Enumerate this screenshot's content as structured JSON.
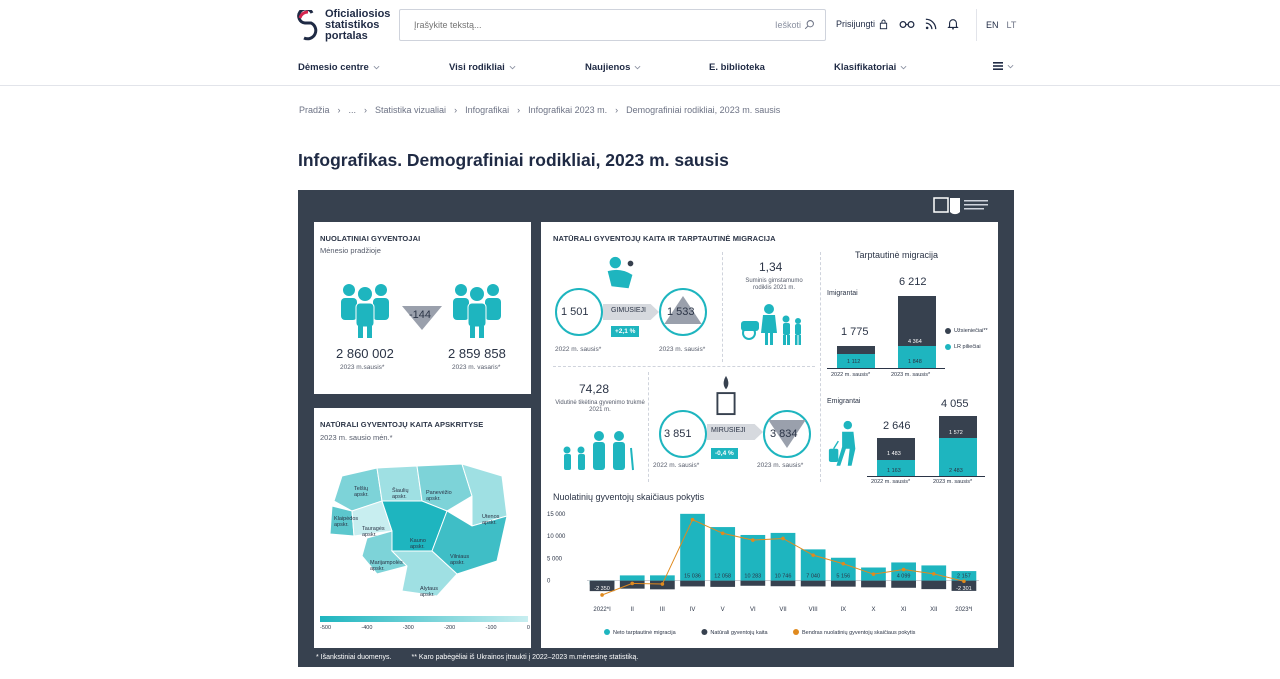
{
  "header": {
    "logo_lines": [
      "Oficialiosios",
      "statistikos",
      "portalas"
    ],
    "search_placeholder": "Įrašykite tekstą...",
    "search_button": "Ieškoti",
    "login": "Prisijungti",
    "lang_en": "EN",
    "lang_lt": "LT"
  },
  "nav": {
    "items": [
      "Dėmesio centre",
      "Visi rodikliai",
      "Naujienos",
      "E. biblioteka",
      "Klasifikatoriai"
    ]
  },
  "breadcrumb": [
    "Pradžia",
    "...",
    "Statistika vizualiai",
    "Infografikai",
    "Infografikai 2023 m.",
    "Demografiniai rodikliai, 2023 m. sausis"
  ],
  "page_title": "Infografikas. Demografiniai rodikliai, 2023 m. sausis",
  "infographic": {
    "pop": {
      "title": "NUOLATINIAI GYVENTOJAI",
      "subtitle": "Mėnesio pradžioje",
      "delta": "-144",
      "left_value": "2 860 002",
      "left_label": "2023 m.sausis*",
      "right_value": "2 859 858",
      "right_label": "2023 m. vasaris*"
    },
    "map": {
      "title": "NATŪRALI GYVENTOJŲ KAITA APSKRITYSE",
      "subtitle": "2023 m. sausio mėn.*",
      "regions": [
        "Telšių apskr.",
        "Šiaulių apskr.",
        "Panevėžio apskr.",
        "Klaipėdos apskr.",
        "Tauragės apskr.",
        "Utenos apskr.",
        "Kauno apskr.",
        "Marijampolės apskr.",
        "Vilniaus apskr.",
        "Alytaus apskr."
      ],
      "scale": [
        "-500",
        "-400",
        "-300",
        "-200",
        "-100",
        "0"
      ]
    },
    "natural": {
      "title": "NATŪRALI GYVENTOJŲ KAITA IR TARPTAUTINĖ MIGRACIJA",
      "births_left": "1 501",
      "births_right": "1 533",
      "births_label": "GIMUSIEJI",
      "births_change": "+2,1 %",
      "date_left": "2022 m. sausis*",
      "date_right": "2023 m. sausis*",
      "fertility_value": "1,34",
      "fertility_label": "Suminis gimstamumo rodiklis 2021 m.",
      "life_value": "74,28",
      "life_label": "Vidutinė tikėtina gyvenimo trukmė 2021 m.",
      "deaths_left": "3 851",
      "deaths_right": "3 834",
      "deaths_label": "MIRUSIEJI",
      "deaths_change": "-0,4 %"
    },
    "migration": {
      "title": "Tarptautinė migracija",
      "immigrants": "Imigrantai",
      "emigrants": "Emigrantai",
      "imm_left_total": "1 775",
      "imm_left_lt": "1 112",
      "imm_right_total": "6 212",
      "imm_right_foreign": "4 364",
      "imm_right_lt": "1 848",
      "emi_left_total": "2 646",
      "emi_left_foreign": "1 483",
      "emi_left_lt": "1 163",
      "emi_right_total": "4 055",
      "emi_right_foreign": "1 572",
      "emi_right_lt": "2 483",
      "legend_foreign": "Užsieniečiai**",
      "legend_lt": "LR piliečiai",
      "date_left": "2022 m. sausis*",
      "date_right": "2023 m. sausis*"
    },
    "footer_1": "* Išankstiniai duomenys.",
    "footer_2": "** Karo pabėgėliai iš Ukrainos įtraukti į 2022–2023 m.mėnesinę statistiką."
  },
  "chart_data": {
    "type": "bar",
    "title": "Nuolatinių gyventojų skaičiaus pokytis",
    "categories": [
      "2022*I",
      "II",
      "III",
      "IV",
      "V",
      "VI",
      "VII",
      "VIII",
      "IX",
      "X",
      "XI",
      "XII",
      "2023*I"
    ],
    "ylim": [
      -3000,
      15000
    ],
    "yticks": [
      "15 000",
      "10 000",
      "5 000",
      "0"
    ],
    "series": [
      {
        "name": "Neto tarptautinė migracija",
        "color": "#1eb5bf",
        "values": [
          -871,
          1185,
          1194,
          15036,
          12058,
          10283,
          10746,
          7040,
          5156,
          2961,
          4099,
          3430,
          2157
        ],
        "labels": [
          "",
          "",
          "",
          "15 036",
          "12 058",
          "10 283",
          "10 746",
          "7 040",
          "5 156",
          "",
          "4 099",
          "",
          "2 157"
        ]
      },
      {
        "name": "Natūrali gyventojų kaita",
        "color": "#37414f",
        "values": [
          -2350,
          -1800,
          -1950,
          -1300,
          -1400,
          -1150,
          -1250,
          -1300,
          -1350,
          -1500,
          -1600,
          -1900,
          -2301
        ],
        "labels": [
          "-2 350",
          "",
          "",
          "",
          "",
          "",
          "",
          "",
          "",
          "",
          "",
          "",
          "-2 301"
        ]
      },
      {
        "name": "Bendras nuolatinių gyventojų skaičiaus pokytis",
        "color": "#e08a1e",
        "values": [
          -3221,
          -615,
          -756,
          13736,
          10658,
          9133,
          9496,
          5740,
          3806,
          1461,
          2499,
          1530,
          -144
        ]
      }
    ]
  }
}
